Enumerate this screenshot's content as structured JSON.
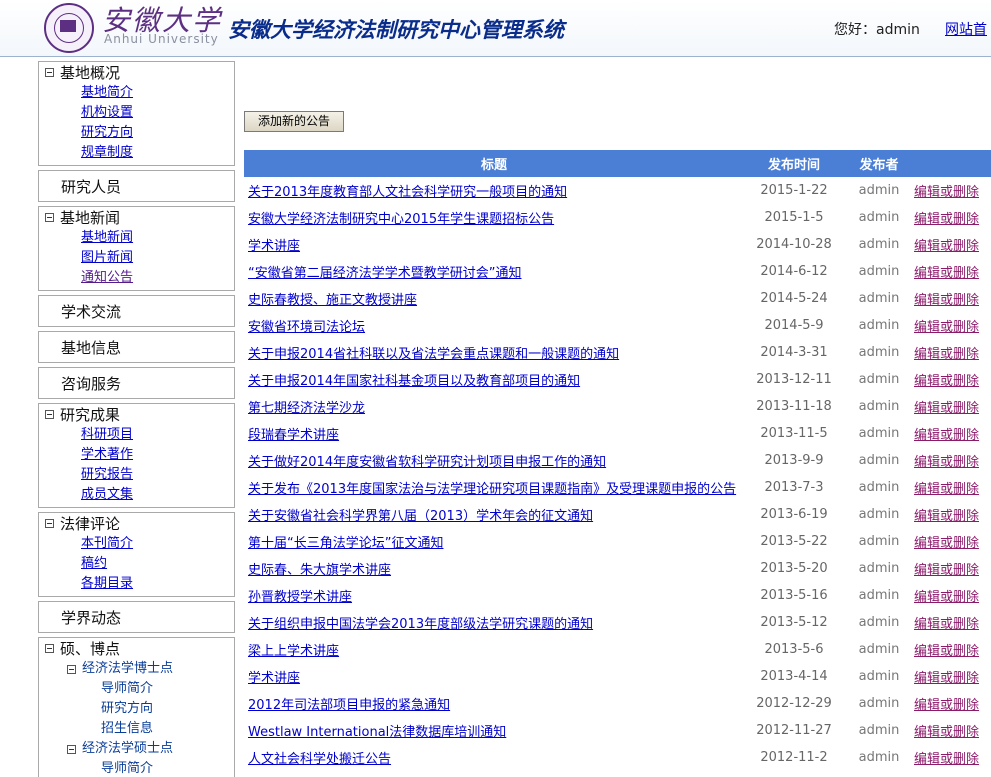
{
  "header": {
    "univ_cn": "安徽大学",
    "univ_en": "Anhui University",
    "system_title": "安徽大学经济法制研究中心管理系统",
    "greeting": "您好：admin",
    "site_home": "网站首"
  },
  "sidebar": {
    "sections": [
      {
        "title": "基地概况",
        "items": [
          "基地简介",
          "机构设置",
          "研究方向",
          "规章制度"
        ]
      },
      {
        "title": "研究人员"
      },
      {
        "title": "基地新闻",
        "items": [
          "基地新闻",
          "图片新闻",
          "通知公告"
        ]
      },
      {
        "title": "学术交流"
      },
      {
        "title": "基地信息"
      },
      {
        "title": "咨询服务"
      },
      {
        "title": "研究成果",
        "items": [
          "科研项目",
          "学术著作",
          "研究报告",
          "成员文集"
        ]
      },
      {
        "title": "法律评论",
        "items": [
          "本刊简介",
          "稿约",
          "各期目录"
        ]
      },
      {
        "title": "学界动态"
      },
      {
        "title": "硕、博点",
        "groups": [
          {
            "title": "经济法学博士点",
            "items": [
              "导师简介",
              "研究方向",
              "招生信息"
            ]
          },
          {
            "title": "经济法学硕士点",
            "items": [
              "导师简介"
            ]
          }
        ]
      }
    ]
  },
  "main": {
    "add_button": "添加新的公告",
    "columns": [
      "标题",
      "发布时间",
      "发布者",
      ""
    ],
    "action_label": "编辑或删除",
    "rows": [
      {
        "title": "关于2013年度教育部人文社会科学研究一般项目的通知",
        "date": "2015-1-22",
        "publisher": "admin"
      },
      {
        "title": "安徽大学经济法制研究中心2015年学生课题招标公告",
        "date": "2015-1-5",
        "publisher": "admin"
      },
      {
        "title": "学术讲座",
        "date": "2014-10-28",
        "publisher": "admin"
      },
      {
        "title": "“安徽省第二届经济法学学术暨教学研讨会”通知",
        "date": "2014-6-12",
        "publisher": "admin"
      },
      {
        "title": "史际春教授、施正文教授讲座",
        "date": "2014-5-24",
        "publisher": "admin"
      },
      {
        "title": "安徽省环境司法论坛",
        "date": "2014-5-9",
        "publisher": "admin"
      },
      {
        "title": "关于申报2014省社科联以及省法学会重点课题和一般课题的通知",
        "date": "2014-3-31",
        "publisher": "admin"
      },
      {
        "title": "关于申报2014年国家社科基金项目以及教育部项目的通知",
        "date": "2013-12-11",
        "publisher": "admin"
      },
      {
        "title": "第七期经济法学沙龙",
        "date": "2013-11-18",
        "publisher": "admin"
      },
      {
        "title": "段瑞春学术讲座",
        "date": "2013-11-5",
        "publisher": "admin"
      },
      {
        "title": "关于做好2014年度安徽省软科学研究计划项目申报工作的通知",
        "date": "2013-9-9",
        "publisher": "admin"
      },
      {
        "title": "关于发布《2013年度国家法治与法学理论研究项目课题指南》及受理课题申报的公告",
        "date": "2013-7-3",
        "publisher": "admin"
      },
      {
        "title": "关于安徽省社会科学界第八届（2013）学术年会的征文通知",
        "date": "2013-6-19",
        "publisher": "admin"
      },
      {
        "title": "第十届“长三角法学论坛”征文通知",
        "date": "2013-5-22",
        "publisher": "admin"
      },
      {
        "title": "史际春、朱大旗学术讲座",
        "date": "2013-5-20",
        "publisher": "admin"
      },
      {
        "title": "孙晋教授学术讲座",
        "date": "2013-5-16",
        "publisher": "admin"
      },
      {
        "title": "关于组织申报中国法学会2013年度部级法学研究课题的通知",
        "date": "2013-5-12",
        "publisher": "admin"
      },
      {
        "title": "梁上上学术讲座",
        "date": "2013-5-6",
        "publisher": "admin"
      },
      {
        "title": "学术讲座",
        "date": "2013-4-14",
        "publisher": "admin"
      },
      {
        "title": "2012年司法部项目申报的紧急通知",
        "date": "2012-12-29",
        "publisher": "admin"
      },
      {
        "title": "Westlaw International法律数据库培训通知",
        "date": "2012-11-27",
        "publisher": "admin"
      },
      {
        "title": "人文社会科学处搬迁公告",
        "date": "2012-11-2",
        "publisher": "admin"
      }
    ]
  }
}
